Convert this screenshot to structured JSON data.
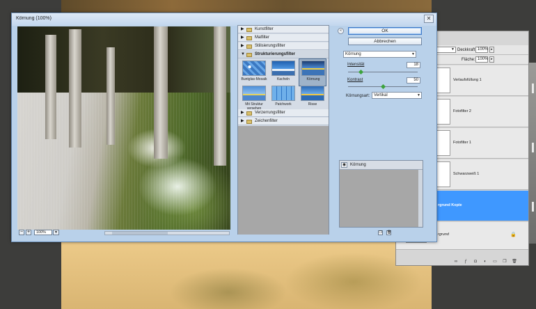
{
  "dialog": {
    "title": "Körnung (100%)",
    "close_glyph": "✕",
    "zoom_value": "100%"
  },
  "gallery": {
    "categories": [
      {
        "label": "Kunstfilter"
      },
      {
        "label": "Malfilter"
      },
      {
        "label": "Stilisierungsfilter"
      },
      {
        "label": "Strukturierungsfilter"
      },
      {
        "label": "Verzerrungsfilter"
      },
      {
        "label": "Zeichenfilter"
      }
    ],
    "thumbs": [
      {
        "label": "Buntglas-Mosaik"
      },
      {
        "label": "Kacheln"
      },
      {
        "label": "Körnung"
      },
      {
        "label": "Mit Struktur versehen"
      },
      {
        "label": "Patchwork"
      },
      {
        "label": "Risse"
      }
    ]
  },
  "settings": {
    "ok_label": "OK",
    "cancel_label": "Abbrechen",
    "filter_select": "Körnung",
    "intensity_label": "Intensität",
    "intensity_value": "18",
    "intensity_fraction": 0.18,
    "contrast_label": "Kontrast",
    "contrast_value": "50",
    "contrast_fraction": 0.5,
    "grain_type_label": "Körnungsart:",
    "grain_type_value": "Vertikal"
  },
  "effects": {
    "layer_label": "Körnung"
  },
  "layers_panel": {
    "opacity_label": "Deckkraft:",
    "opacity_value": "100%",
    "fill_label": "Fläche:",
    "fill_value": "100%",
    "layers": [
      {
        "name": "Verlaufsfüllung 1"
      },
      {
        "name": "Fotofilter 2"
      },
      {
        "name": "Fotofilter 1"
      },
      {
        "name": "Schwarzweiß 1"
      },
      {
        "name": "rgrund Kopie"
      },
      {
        "name": "rgrund"
      }
    ]
  },
  "colors": {
    "selection_blue": "#3f98ff",
    "dialog_chrome": "#b9d1ea",
    "slider_knob": "#3ca23c"
  }
}
